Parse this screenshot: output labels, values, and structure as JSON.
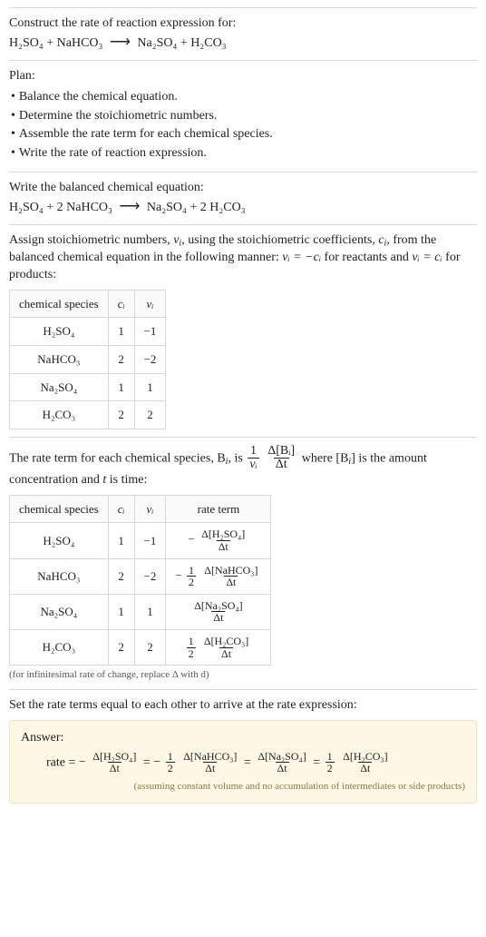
{
  "intro": {
    "prompt": "Construct the rate of reaction expression for:",
    "lhs": "H₂SO₄ + NaHCO₃",
    "rhs": "Na₂SO₄ + H₂CO₃"
  },
  "plan": {
    "heading": "Plan:",
    "items": [
      "Balance the chemical equation.",
      "Determine the stoichiometric numbers.",
      "Assemble the rate term for each chemical species.",
      "Write the rate of reaction expression."
    ]
  },
  "balanced": {
    "prompt": "Write the balanced chemical equation:",
    "lhs": "H₂SO₄ + 2 NaHCO₃",
    "rhs": "Na₂SO₄ + 2 H₂CO₃"
  },
  "stoich_text": {
    "p1a": "Assign stoichiometric numbers, ",
    "nu_i": "ν",
    "sub_i": "i",
    "p1b": ", using the stoichiometric coefficients, ",
    "c_i": "c",
    "p1c": ", from the balanced chemical equation in the following manner: ",
    "rel_react": "νᵢ = −cᵢ",
    "p1d": " for reactants and ",
    "rel_prod": "νᵢ = cᵢ",
    "p1e": " for products:"
  },
  "stoich_table": {
    "h_species": "chemical species",
    "h_c": "cᵢ",
    "h_nu": "νᵢ",
    "rows": [
      {
        "species": "H₂SO₄",
        "c": "1",
        "nu": "−1"
      },
      {
        "species": "NaHCO₃",
        "c": "2",
        "nu": "−2"
      },
      {
        "species": "Na₂SO₄",
        "c": "1",
        "nu": "1"
      },
      {
        "species": "H₂CO₃",
        "c": "2",
        "nu": "2"
      }
    ]
  },
  "rate_text": {
    "a": "The rate term for each chemical species, B",
    "b": ", is ",
    "one": "1",
    "nu": "νᵢ",
    "dBi": "Δ[Bᵢ]",
    "dt": "Δt",
    "c": " where [B",
    "d": "] is the amount concentration and ",
    "t": "t",
    "e": " is time:"
  },
  "rate_table": {
    "h_species": "chemical species",
    "h_c": "cᵢ",
    "h_nu": "νᵢ",
    "h_rate": "rate term",
    "rows": [
      {
        "species": "H₂SO₄",
        "c": "1",
        "nu": "−1",
        "coef_num": "",
        "coef_den": "",
        "sign": "−",
        "conc": "Δ[H₂SO₄]",
        "dt": "Δt"
      },
      {
        "species": "NaHCO₃",
        "c": "2",
        "nu": "−2",
        "coef_num": "1",
        "coef_den": "2",
        "sign": "−",
        "conc": "Δ[NaHCO₃]",
        "dt": "Δt"
      },
      {
        "species": "Na₂SO₄",
        "c": "1",
        "nu": "1",
        "coef_num": "",
        "coef_den": "",
        "sign": "",
        "conc": "Δ[Na₂SO₄]",
        "dt": "Δt"
      },
      {
        "species": "H₂CO₃",
        "c": "2",
        "nu": "2",
        "coef_num": "1",
        "coef_den": "2",
        "sign": "",
        "conc": "Δ[H₂CO₃]",
        "dt": "Δt"
      }
    ],
    "note": "(for infinitesimal rate of change, replace Δ with d)"
  },
  "final_prompt": "Set the rate terms equal to each other to arrive at the rate expression:",
  "answer": {
    "label": "Answer:",
    "rate": "rate = ",
    "terms": [
      {
        "sign": "−",
        "coef_num": "",
        "coef_den": "",
        "conc": "Δ[H₂SO₄]",
        "dt": "Δt"
      },
      {
        "sign": "−",
        "coef_num": "1",
        "coef_den": "2",
        "conc": "Δ[NaHCO₃]",
        "dt": "Δt"
      },
      {
        "sign": "",
        "coef_num": "",
        "coef_den": "",
        "conc": "Δ[Na₂SO₄]",
        "dt": "Δt"
      },
      {
        "sign": "",
        "coef_num": "1",
        "coef_den": "2",
        "conc": "Δ[H₂CO₃]",
        "dt": "Δt"
      }
    ],
    "eq": " = ",
    "note": "(assuming constant volume and no accumulation of intermediates or side products)"
  },
  "chart_data": {
    "type": "table",
    "title": "Stoichiometric numbers and rate terms",
    "tables": [
      {
        "columns": [
          "chemical species",
          "c_i",
          "nu_i"
        ],
        "rows": [
          [
            "H2SO4",
            1,
            -1
          ],
          [
            "NaHCO3",
            2,
            -2
          ],
          [
            "Na2SO4",
            1,
            1
          ],
          [
            "H2CO3",
            2,
            2
          ]
        ]
      },
      {
        "columns": [
          "chemical species",
          "c_i",
          "nu_i",
          "rate term"
        ],
        "rows": [
          [
            "H2SO4",
            1,
            -1,
            "-(Δ[H2SO4]/Δt)"
          ],
          [
            "NaHCO3",
            2,
            -2,
            "-(1/2)(Δ[NaHCO3]/Δt)"
          ],
          [
            "Na2SO4",
            1,
            1,
            "(Δ[Na2SO4]/Δt)"
          ],
          [
            "H2CO3",
            2,
            2,
            "(1/2)(Δ[H2CO3]/Δt)"
          ]
        ]
      }
    ]
  }
}
